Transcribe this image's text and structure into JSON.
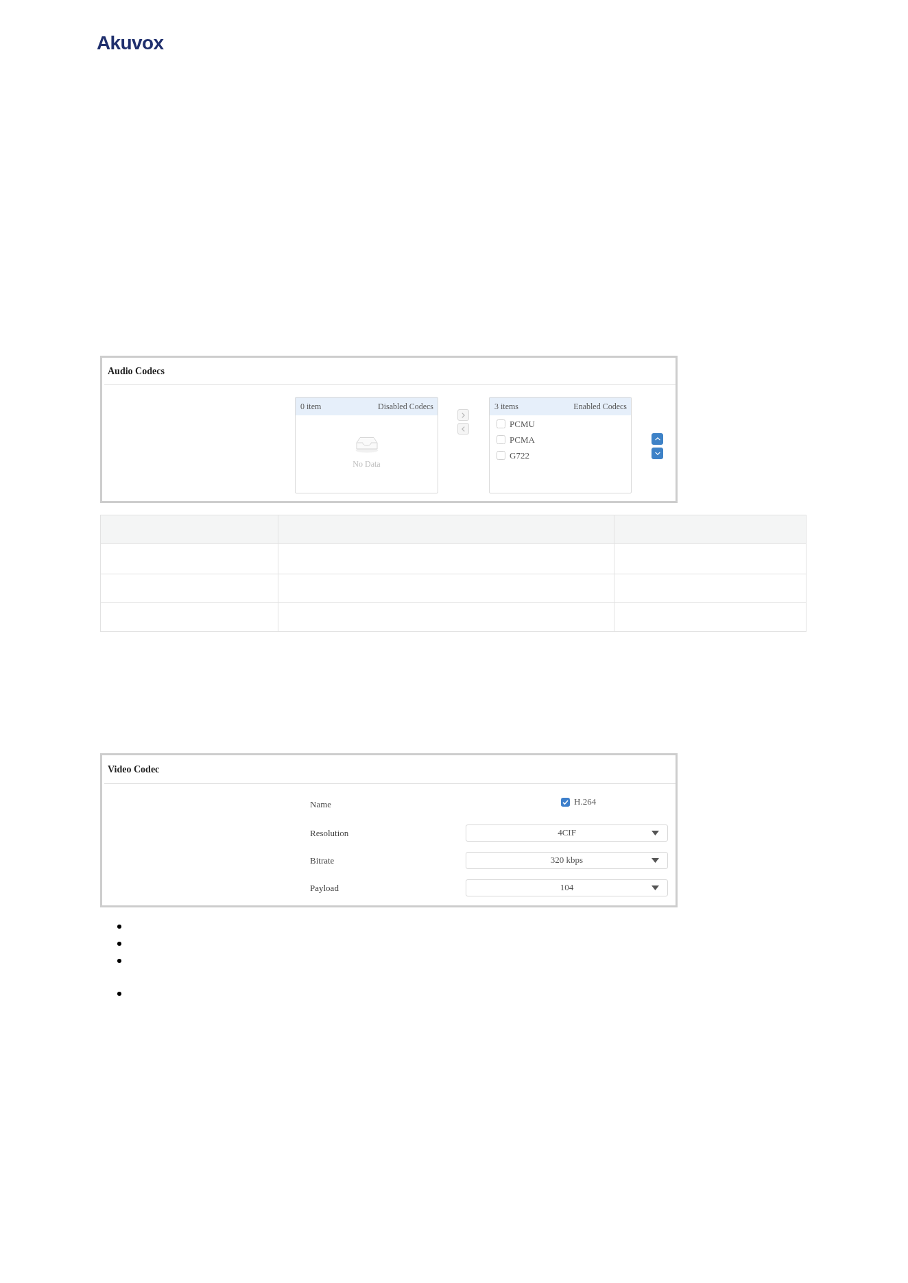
{
  "logo": {
    "text": "Akuvox"
  },
  "audio_codecs": {
    "title": "Audio Codecs",
    "disabled_list": {
      "count": "0 item",
      "title": "Disabled Codecs",
      "empty_text": "No Data"
    },
    "transfer_buttons": [
      {
        "disabled": true
      },
      {
        "disabled": true
      }
    ],
    "enabled_list": {
      "count": "3 items",
      "title": "Enabled Codecs",
      "items": [
        {
          "label": "PCMU",
          "checked": false
        },
        {
          "label": "PCMA",
          "checked": false
        },
        {
          "label": "G722",
          "checked": false
        }
      ]
    },
    "order_buttons": [
      {
        "disabled": false
      },
      {
        "disabled": false
      }
    ]
  },
  "video_codec": {
    "title": "Video Codec",
    "fields": [
      {
        "kind": "checkbox",
        "label": "Name",
        "value": "H.264",
        "checked": true
      },
      {
        "kind": "select",
        "label": "Resolution",
        "value": "4CIF"
      },
      {
        "kind": "select",
        "label": "Bitrate",
        "value": "320 kbps"
      },
      {
        "kind": "select",
        "label": "Payload",
        "value": "104"
      }
    ]
  }
}
